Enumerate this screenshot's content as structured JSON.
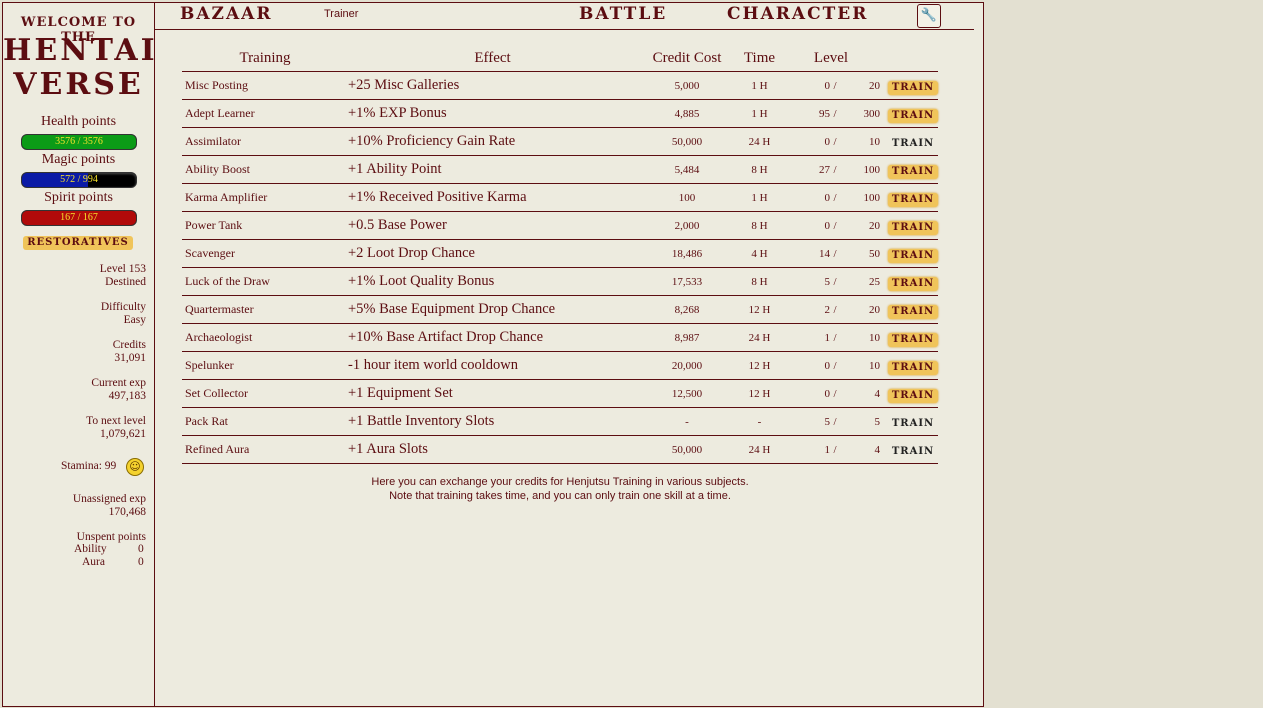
{
  "logo": {
    "welcome": "WELCOME TO THE",
    "line1": "HENTAI",
    "line2": "VERSE"
  },
  "vitals": {
    "health": {
      "label": "Health points",
      "value": "3576 / 3576",
      "fraction": 1.0,
      "color": "#0b9b17"
    },
    "magic": {
      "label": "Magic points",
      "value": "572 / 994",
      "fraction": 0.575,
      "color": "#0a1aa6"
    },
    "spirit": {
      "label": "Spirit points",
      "value": "167 / 167",
      "fraction": 1.0,
      "color": "#b10a0a"
    }
  },
  "restoratives_label": "RESTORATIVES",
  "stats": {
    "level_label": "Level 153",
    "level_title": "Destined",
    "difficulty_label": "Difficulty",
    "difficulty_value": "Easy",
    "credits_label": "Credits",
    "credits_value": "31,091",
    "exp_label": "Current exp",
    "exp_value": "497,183",
    "next_label": "To next level",
    "next_value": "1,079,621",
    "stamina_label": "Stamina: 99",
    "unassigned_label": "Unassigned exp",
    "unassigned_value": "170,468",
    "unspent_label": "Unspent points",
    "ability_label": "Ability",
    "ability_value": "0",
    "aura_label": "Aura",
    "aura_value": "0"
  },
  "nav": {
    "bazaar": "BAZAAR",
    "trainer": "Trainer",
    "battle": "BATTLE",
    "character": "CHARACTER",
    "settings_icon": "wrench-icon"
  },
  "table": {
    "headers": {
      "training": "Training",
      "effect": "Effect",
      "cost": "Credit Cost",
      "time": "Time",
      "level": "Level"
    },
    "rows": [
      {
        "name": "Misc Posting",
        "effect": "+25 Misc Galleries",
        "cost": "5,000",
        "time": "1 H",
        "cur": "0",
        "max": "20",
        "train": "TRAIN",
        "available": true
      },
      {
        "name": "Adept Learner",
        "effect": "+1% EXP Bonus",
        "cost": "4,885",
        "time": "1 H",
        "cur": "95",
        "max": "300",
        "train": "TRAIN",
        "available": true
      },
      {
        "name": "Assimilator",
        "effect": "+10% Proficiency Gain Rate",
        "cost": "50,000",
        "time": "24 H",
        "cur": "0",
        "max": "10",
        "train": "TRAIN",
        "available": false
      },
      {
        "name": "Ability Boost",
        "effect": "+1 Ability Point",
        "cost": "5,484",
        "time": "8 H",
        "cur": "27",
        "max": "100",
        "train": "TRAIN",
        "available": true
      },
      {
        "name": "Karma Amplifier",
        "effect": "+1% Received Positive Karma",
        "cost": "100",
        "time": "1 H",
        "cur": "0",
        "max": "100",
        "train": "TRAIN",
        "available": true
      },
      {
        "name": "Power Tank",
        "effect": "+0.5 Base Power",
        "cost": "2,000",
        "time": "8 H",
        "cur": "0",
        "max": "20",
        "train": "TRAIN",
        "available": true
      },
      {
        "name": "Scavenger",
        "effect": "+2 Loot Drop Chance",
        "cost": "18,486",
        "time": "4 H",
        "cur": "14",
        "max": "50",
        "train": "TRAIN",
        "available": true
      },
      {
        "name": "Luck of the Draw",
        "effect": "+1% Loot Quality Bonus",
        "cost": "17,533",
        "time": "8 H",
        "cur": "5",
        "max": "25",
        "train": "TRAIN",
        "available": true
      },
      {
        "name": "Quartermaster",
        "effect": "+5% Base Equipment Drop Chance",
        "cost": "8,268",
        "time": "12 H",
        "cur": "2",
        "max": "20",
        "train": "TRAIN",
        "available": true
      },
      {
        "name": "Archaeologist",
        "effect": "+10% Base Artifact Drop Chance",
        "cost": "8,987",
        "time": "24 H",
        "cur": "1",
        "max": "10",
        "train": "TRAIN",
        "available": true
      },
      {
        "name": "Spelunker",
        "effect": "-1 hour item world cooldown",
        "cost": "20,000",
        "time": "12 H",
        "cur": "0",
        "max": "10",
        "train": "TRAIN",
        "available": true
      },
      {
        "name": "Set Collector",
        "effect": "+1 Equipment Set",
        "cost": "12,500",
        "time": "12 H",
        "cur": "0",
        "max": "4",
        "train": "TRAIN",
        "available": true
      },
      {
        "name": "Pack Rat",
        "effect": "+1 Battle Inventory Slots",
        "cost": "-",
        "time": "-",
        "cur": "5",
        "max": "5",
        "train": "TRAIN",
        "available": false
      },
      {
        "name": "Refined Aura",
        "effect": "+1 Aura Slots",
        "cost": "50,000",
        "time": "24 H",
        "cur": "1",
        "max": "4",
        "train": "TRAIN",
        "available": false
      }
    ]
  },
  "footer": {
    "line1": "Here you can exchange your credits for Henjutsu Training in various subjects.",
    "line2": "Note that training takes time, and you can only train one skill at a time."
  }
}
